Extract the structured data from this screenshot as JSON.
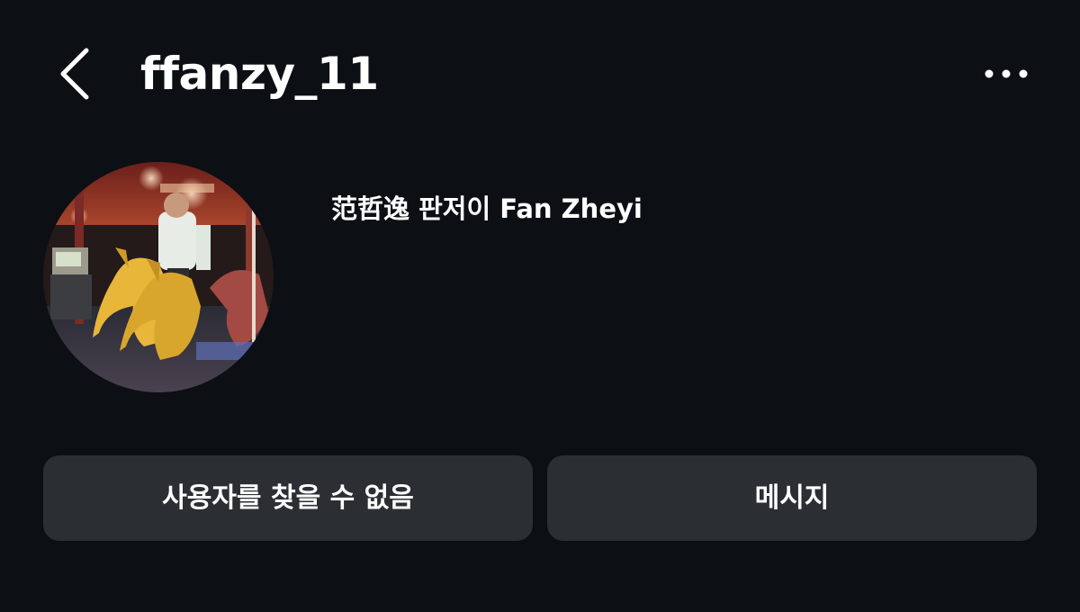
{
  "header": {
    "username": "ffanzy_11",
    "back_icon": "chevron-left-icon",
    "more_icon": "more-horizontal-icon"
  },
  "profile": {
    "display_name": "范哲逸 판저이 Fan Zheyi",
    "avatar_description": "profile photo"
  },
  "actions": {
    "unavailable_label": "사용자를 찾을 수 없음",
    "message_label": "메시지"
  },
  "colors": {
    "background": "#0c0f14",
    "button_background": "#2b2e33",
    "text": "#ffffff"
  }
}
